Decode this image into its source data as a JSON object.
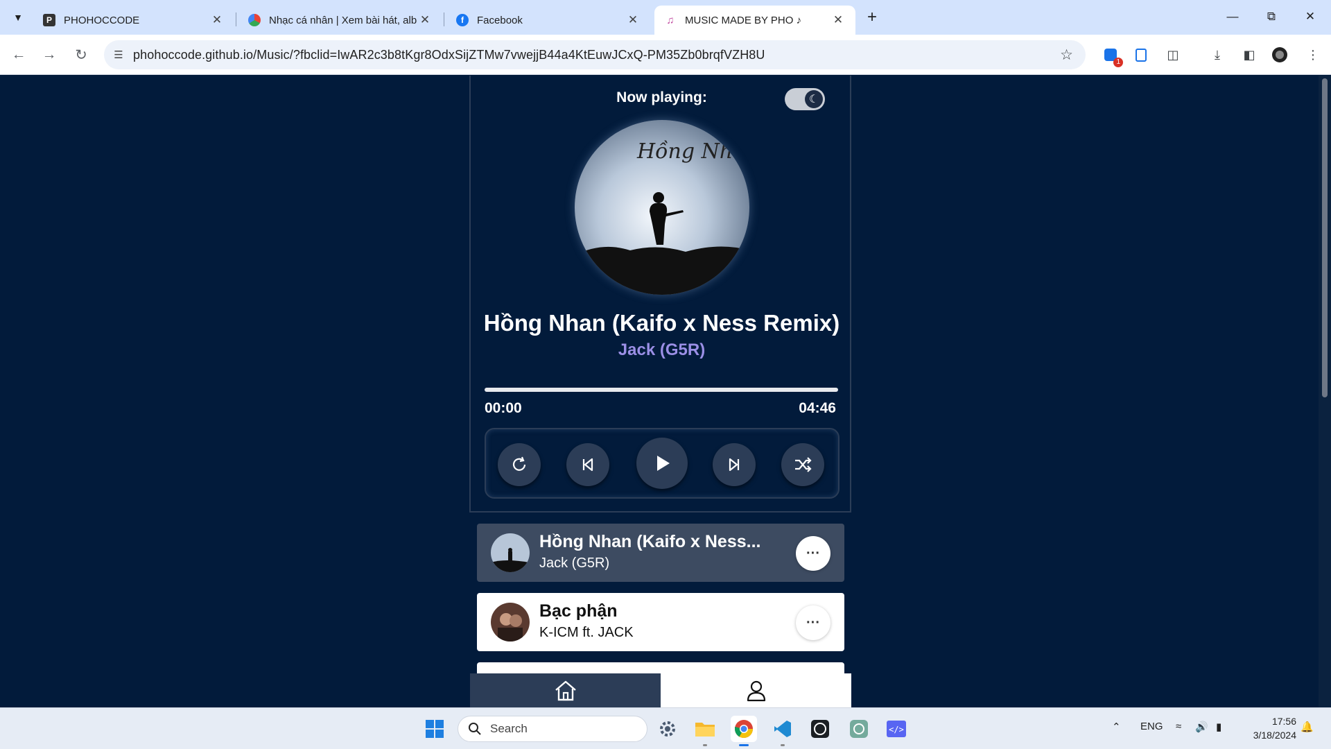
{
  "browser": {
    "tabs": [
      {
        "title": "PHOHOCCODE",
        "favicon": "phohoccode-icon"
      },
      {
        "title": "Nhạc cá nhân | Xem bài hát, album",
        "favicon": "zing-icon"
      },
      {
        "title": "Facebook",
        "favicon": "facebook-icon"
      },
      {
        "title": "MUSIC MADE BY PHO ♪",
        "favicon": "music-icon"
      }
    ],
    "active_tab_index": 3,
    "url": "phohoccode.github.io/Music/?fbclid=IwAR2c3b8tKgr8OdxSijZTMw7vwejjB44a4KtEuwJCxQ-PM35Zb0brqfVZH8U",
    "extension_badge": "1"
  },
  "player": {
    "now_playing_label": "Now playing:",
    "dark_mode": true,
    "title": "Hồng Nhan (Kaifo x Ness Remix)",
    "artist": "Jack (G5R)",
    "current_time": "00:00",
    "duration": "04:46",
    "progress": 0,
    "cover_text": "Hồng Nhan",
    "controls": [
      "repeat-icon",
      "previous-icon",
      "play-icon",
      "next-icon",
      "shuffle-icon"
    ]
  },
  "playlist": [
    {
      "title": "Hồng Nhan (Kaifo x Ness Remix)",
      "title_display": "Hồng Nhan (Kaifo x Ness...",
      "artist": "Jack (G5R)",
      "active": true
    },
    {
      "title": "Bạc phận",
      "artist": "K-ICM ft. JACK",
      "active": false
    }
  ],
  "bottom_nav": [
    "home-icon",
    "user-icon"
  ],
  "taskbar": {
    "search_placeholder": "Search",
    "language": "ENG",
    "time": "17:56",
    "date": "3/18/2024"
  },
  "colors": {
    "page_bg": "#021b3b",
    "accent": "#9b8fe6",
    "button_bg": "#2c3d57"
  }
}
